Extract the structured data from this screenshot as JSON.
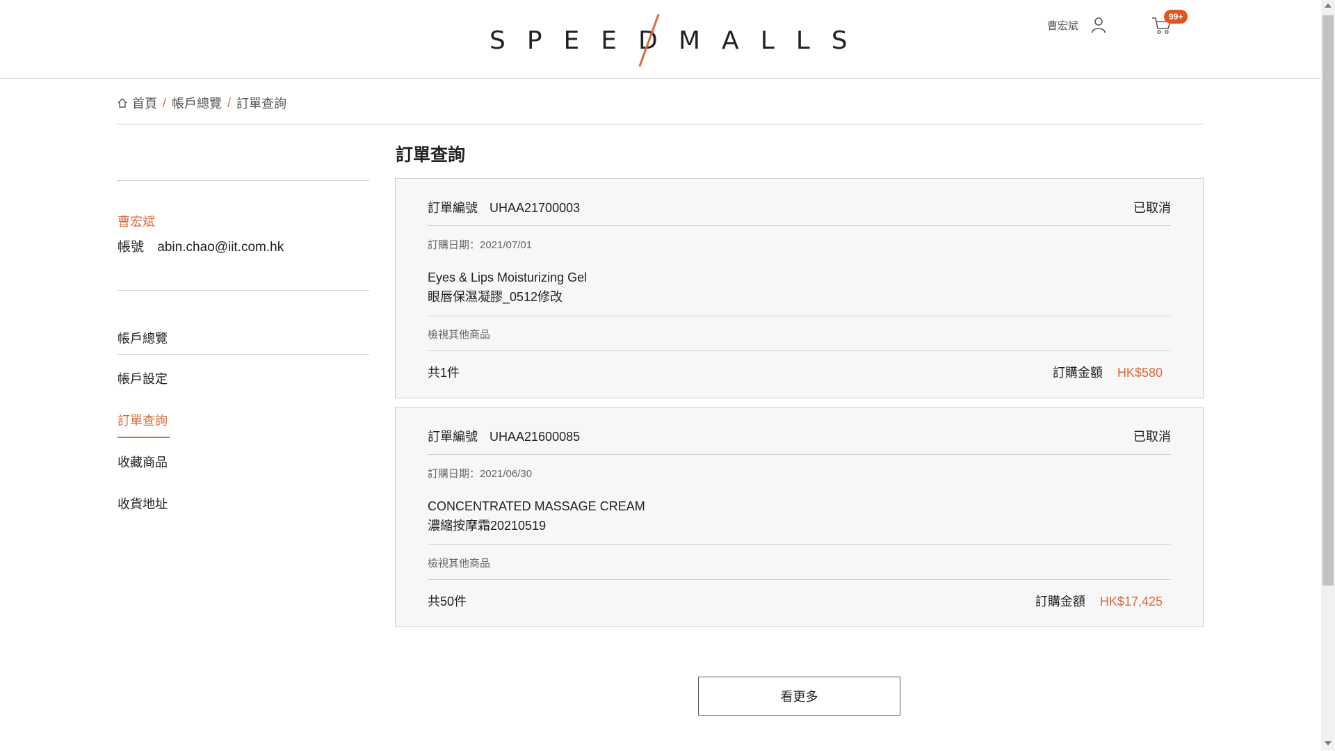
{
  "brand": {
    "left": "SPEED",
    "right": "MALLS",
    "accent_color": "#d86a3c"
  },
  "header": {
    "user_name": "曹宏斌",
    "cart_badge": "99+"
  },
  "breadcrumb": {
    "home": "首頁",
    "account": "帳戶總覽",
    "current": "訂單查詢",
    "separator": "/"
  },
  "sidebar": {
    "name": "曹宏斌",
    "account_label": "帳號",
    "account_value": "abin.chao@iit.com.hk",
    "nav": [
      {
        "label": "帳戶總覽"
      },
      {
        "label": "帳戶設定"
      },
      {
        "label": "訂單查詢",
        "active": true
      },
      {
        "label": "收藏商品"
      },
      {
        "label": "收貨地址"
      }
    ]
  },
  "main": {
    "title": "訂單查詢",
    "orders": [
      {
        "number_label": "訂單編號",
        "number": "UHAA21700003",
        "status": "已取消",
        "date": "訂購日期：2021/07/01",
        "product_en": "Eyes & Lips Moisturizing Gel",
        "product_zh": "眼唇保濕凝膠_0512修改",
        "view_more": "檢視其他商品",
        "count": "共1件",
        "amount_label": "訂購金額",
        "amount": "HK$580"
      },
      {
        "number_label": "訂單編號",
        "number": "UHAA21600085",
        "status": "已取消",
        "date": "訂購日期：2021/06/30",
        "product_en": "CONCENTRATED MASSAGE CREAM",
        "product_zh": "濃縮按摩霜20210519",
        "view_more": "檢視其他商品",
        "count": "共50件",
        "amount_label": "訂購金額",
        "amount": "HK$17,425"
      }
    ],
    "more_button": "看更多"
  }
}
